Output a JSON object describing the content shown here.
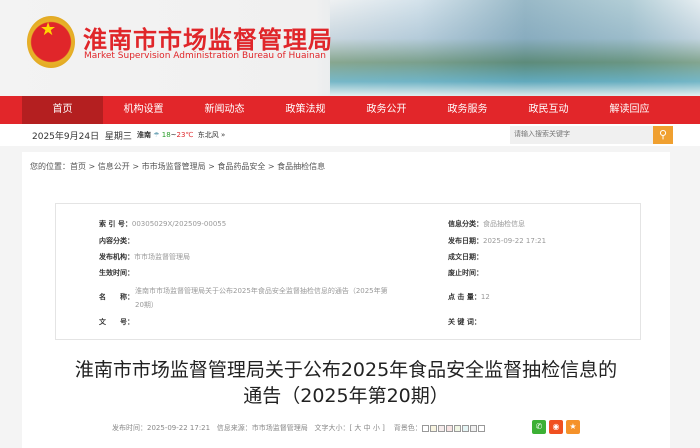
{
  "header": {
    "title": "淮南市市场监督管理局",
    "subtitle": "Market Supervision Administration Bureau of Huainan"
  },
  "nav": [
    "首页",
    "机构设置",
    "新闻动态",
    "政策法规",
    "政务公开",
    "政务服务",
    "政民互动",
    "解读回应"
  ],
  "datebar": {
    "date": "2025年9月24日",
    "weekday": "星期三",
    "city": "淮南",
    "temp_low": "18",
    "temp_sep": "~",
    "temp_high": "23℃",
    "wind": "东北风",
    "more": "»",
    "search_placeholder": "请输入搜索关键字"
  },
  "breadcrumb": "您的位置：首页 > 信息公开 > 市市场监督管理局 > 食品药品安全 > 食品抽检信息",
  "meta": {
    "index_label": "索 引 号：",
    "index": "00305029X/202509-00055",
    "category_label": "信息分类：",
    "category": "食品抽检信息",
    "content_label": "内容分类：",
    "content": "",
    "pubdate_label": "发布日期：",
    "pubdate": "2025-09-22 17:21",
    "org_label": "发布机构：",
    "org": "市市场监督管理局",
    "written_label": "成文日期：",
    "written": "",
    "effective_label": "生效时间：",
    "effective": "",
    "abolish_label": "废止时间：",
    "abolish": "",
    "name_label": "名　　称：",
    "name": "淮南市市场监督管理局关于公布2025年食品安全监督抽检信息的通告（2025年第20期）",
    "clicks_label": "点 击 量：",
    "clicks": "12",
    "docno_label": "文　　号：",
    "docno": "",
    "keywords_label": "关 键 词：",
    "keywords": ""
  },
  "article": {
    "title_line1": "淮南市市场监督管理局关于公布2025年食品安全监督抽检信息的",
    "title_line2": "通告（2025年第20期）",
    "pubtime": "发布时间：2025-09-22 17:21",
    "source": "信息来源：市市场监督管理局",
    "fontsize": "文字大小：[ 大 中 小 ]",
    "bgcolor": "背景色："
  },
  "colors": {
    "brand": "#e2262a",
    "active": "#b41f20",
    "search": "#f0a030"
  }
}
